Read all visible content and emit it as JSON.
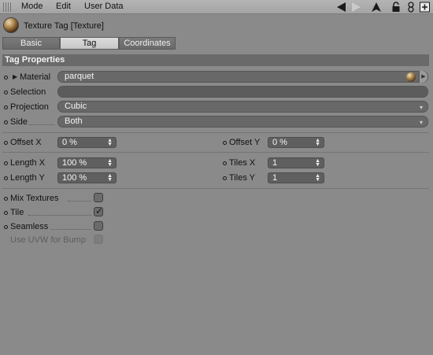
{
  "menubar": {
    "items": [
      "Mode",
      "Edit",
      "User Data"
    ]
  },
  "header": {
    "title": "Texture Tag [Texture]"
  },
  "tabs": [
    {
      "label": "Basic"
    },
    {
      "label": "Tag"
    },
    {
      "label": "Coordinates"
    }
  ],
  "section": {
    "title": "Tag Properties"
  },
  "fields": {
    "material": {
      "label": "Material",
      "value": "parquet"
    },
    "selection": {
      "label": "Selection",
      "value": ""
    },
    "projection": {
      "label": "Projection",
      "value": "Cubic"
    },
    "side": {
      "label": "Side",
      "value": "Both"
    },
    "offset_x": {
      "label": "Offset X",
      "value": "0 %"
    },
    "offset_y": {
      "label": "Offset Y",
      "value": "0 %"
    },
    "length_x": {
      "label": "Length X",
      "value": "100 %"
    },
    "length_y": {
      "label": "Length Y",
      "value": "100 %"
    },
    "tiles_x": {
      "label": "Tiles X",
      "value": "1"
    },
    "tiles_y": {
      "label": "Tiles Y",
      "value": "1"
    }
  },
  "checkboxes": {
    "mix_textures": {
      "label": "Mix Textures",
      "checked": false
    },
    "tile": {
      "label": "Tile",
      "checked": true
    },
    "seamless": {
      "label": "Seamless",
      "checked": false
    },
    "use_uvw": {
      "label": "Use UVW for Bump",
      "checked": false,
      "enabled": false
    }
  },
  "glyphs": {
    "check": "✓",
    "spin": "▲▼",
    "dropdown": "▾",
    "expand": "▶"
  },
  "colors": {
    "panel_bg": "#8a8a8a",
    "section_bg": "#6a6a6a",
    "field_bg": "#686868",
    "active_tab": "#d4d4d4"
  }
}
